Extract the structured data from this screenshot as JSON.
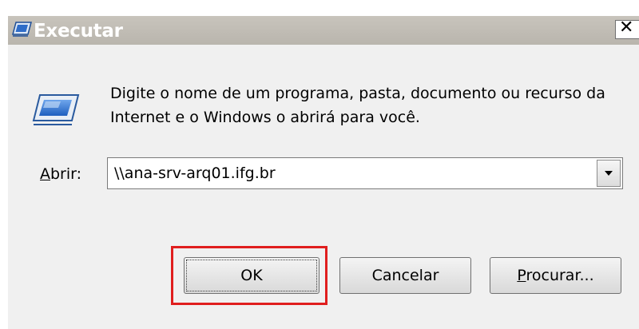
{
  "window": {
    "title": "Executar",
    "close_glyph": "✕",
    "icon": "run-icon"
  },
  "content": {
    "icon": "run-icon",
    "description": "Digite o nome de um programa, pasta, documento ou recurso da Internet e o Windows o abrirá para você."
  },
  "open_field": {
    "label_first": "A",
    "label_rest": "brir:",
    "value": "\\\\ana-srv-arq01.ifg.br"
  },
  "buttons": {
    "ok": "OK",
    "cancel": "Cancelar",
    "browse_first": "P",
    "browse_rest": "rocurar..."
  },
  "colors": {
    "highlight": "#e01e1e",
    "titlebar": "#c2bfb8",
    "dialog_bg": "#f0f0f0"
  }
}
